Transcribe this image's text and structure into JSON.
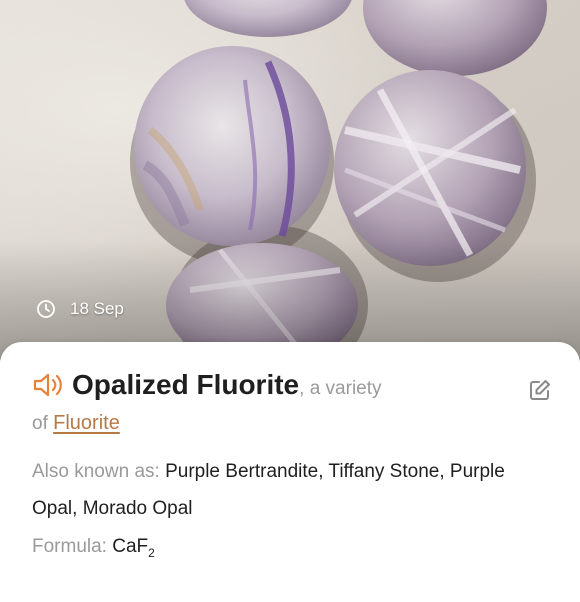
{
  "photo": {
    "date_label": "18 Sep"
  },
  "mineral": {
    "name": "Opalized Fluorite",
    "variety_text": ", a variety",
    "of_text": "of",
    "parent_link": "Fluorite"
  },
  "details": {
    "aka_label": "Also known as:",
    "aka_values": "Purple Bertrandite, Tiffany Stone, Purple Opal, Morado Opal",
    "formula_label": "Formula:",
    "formula_base": "CaF",
    "formula_subscript": "2"
  },
  "colors": {
    "accent": "#E8823A",
    "link": "#B87A45",
    "muted": "#9A9A9A",
    "text": "#1F1F1F"
  },
  "icons": [
    "clock-icon",
    "speaker-icon",
    "edit-icon"
  ]
}
